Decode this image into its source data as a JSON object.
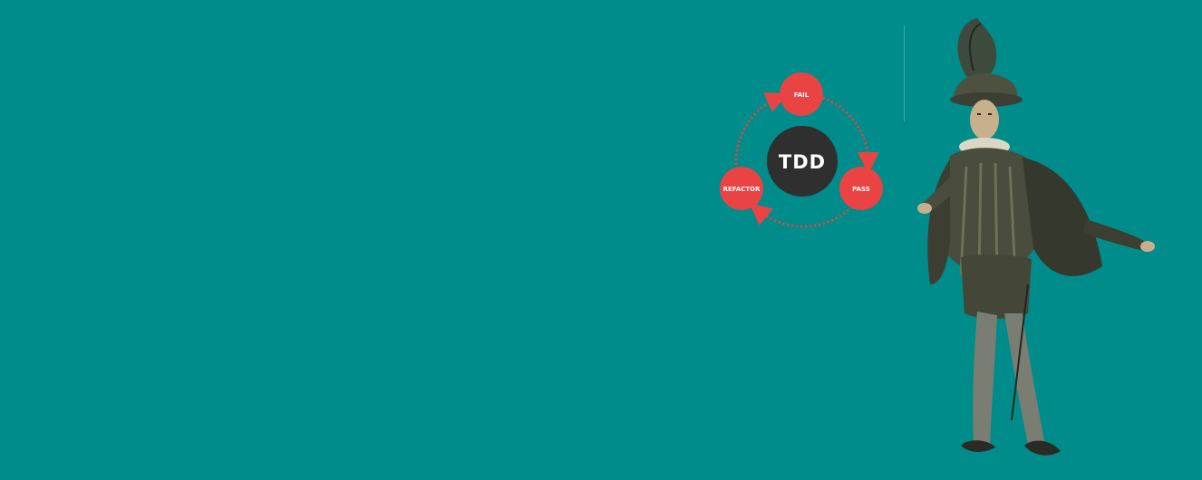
{
  "colors": {
    "background": "#008c8a",
    "node_red": "#ea4343",
    "center_dark": "#2f2f2f",
    "arrow_red": "#ea4343",
    "text_white": "#ffffff",
    "divider": "#6fb9b7"
  },
  "diagram": {
    "center_label": "TDD",
    "nodes": {
      "fail": "FAIL",
      "pass": "PASS",
      "refactor": "REFACTOR"
    }
  },
  "illustration": {
    "icon": "costumed-gentleman-illustration"
  }
}
